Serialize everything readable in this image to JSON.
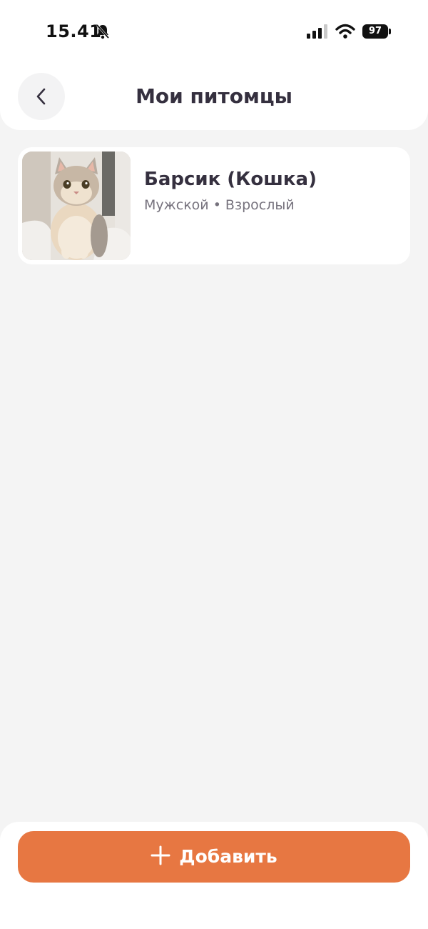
{
  "status_bar": {
    "time": "15.41",
    "battery_level": "97"
  },
  "header": {
    "title": "Мои питомцы",
    "back_icon": "chevron-left-icon"
  },
  "pets": [
    {
      "name": "Барсик (Кошка)",
      "details": "Мужской • Взрослый",
      "photo": "cat-photo"
    }
  ],
  "footer": {
    "add_label": "Добавить",
    "add_icon": "plus-icon"
  },
  "colors": {
    "accent": "#e77742",
    "background": "#f4f4f4",
    "card": "#ffffff",
    "title_text": "#35303f",
    "secondary_text": "#76727d"
  }
}
